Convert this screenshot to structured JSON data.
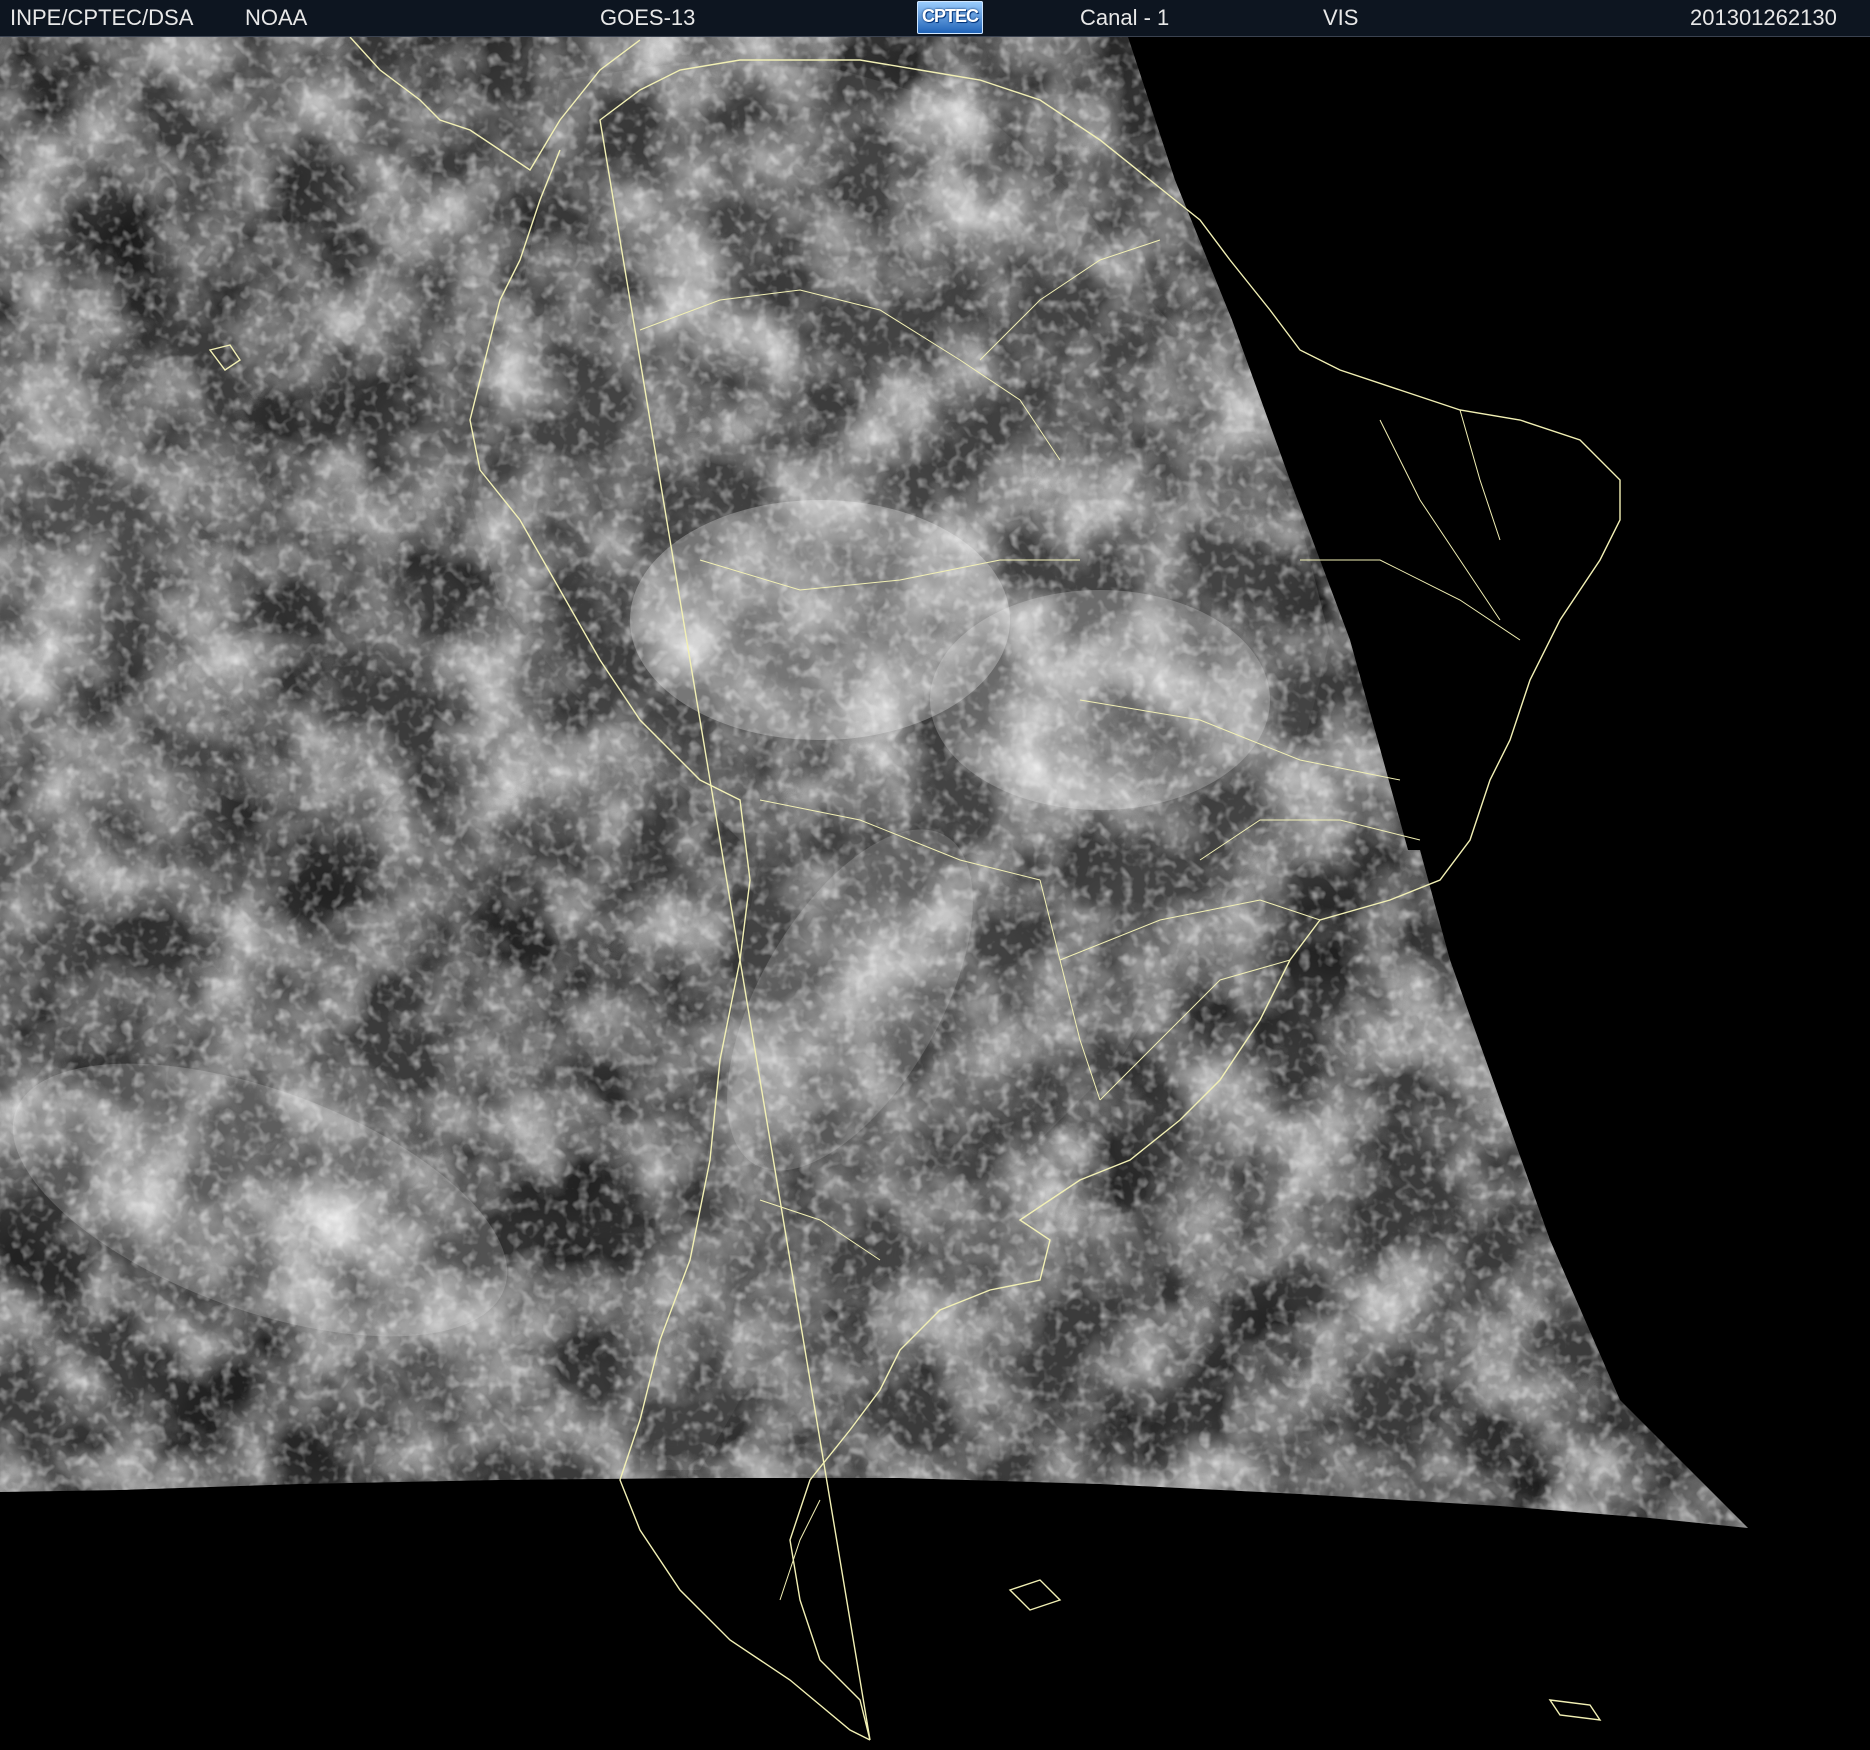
{
  "header": {
    "agency": "INPE/CPTEC/DSA",
    "source": "NOAA",
    "satellite": "GOES-13",
    "logo_text": "CPTEC",
    "channel": "Canal - 1",
    "band": "VIS",
    "timestamp": "201301262130"
  },
  "image": {
    "kind": "visible-channel satellite image of South America",
    "coastline_color": "#f2f0b4",
    "background_color": "#000000"
  }
}
